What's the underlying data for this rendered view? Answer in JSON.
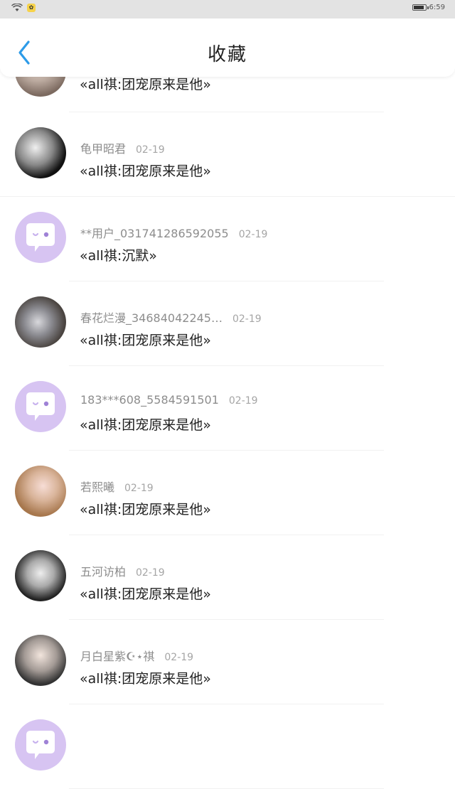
{
  "status_bar": {
    "time": "6:59"
  },
  "header": {
    "title": "收藏"
  },
  "items": [
    {
      "username": "",
      "date": "",
      "message": "«all祺:团宠原来是他»",
      "avatar": "photo0"
    },
    {
      "username": "龟甲昭君",
      "date": "02-19",
      "message": "«all祺:团宠原来是他»",
      "avatar": "photo1"
    },
    {
      "username": "**用户_031741286592055",
      "date": "02-19",
      "message": "«all祺:沉默»",
      "avatar": "chat"
    },
    {
      "username": "春花烂漫_34684042245…",
      "date": "02-19",
      "message": "«all祺:团宠原来是他»",
      "avatar": "photo2"
    },
    {
      "username": "183***608_5584591501",
      "date": "02-19",
      "message": "«all祺:团宠原来是他»",
      "avatar": "chat"
    },
    {
      "username": "若熙曦",
      "date": "02-19",
      "message": "«all祺:团宠原来是他»",
      "avatar": "photo3"
    },
    {
      "username": "五河访柏",
      "date": "02-19",
      "message": "«all祺:团宠原来是他»",
      "avatar": "photo4"
    },
    {
      "username": "月白星紫☪⋆祺",
      "date": "02-19",
      "message": "«all祺:团宠原来是他»",
      "avatar": "photo5"
    },
    {
      "username": "",
      "date": "",
      "message": "",
      "avatar": "chat"
    }
  ]
}
